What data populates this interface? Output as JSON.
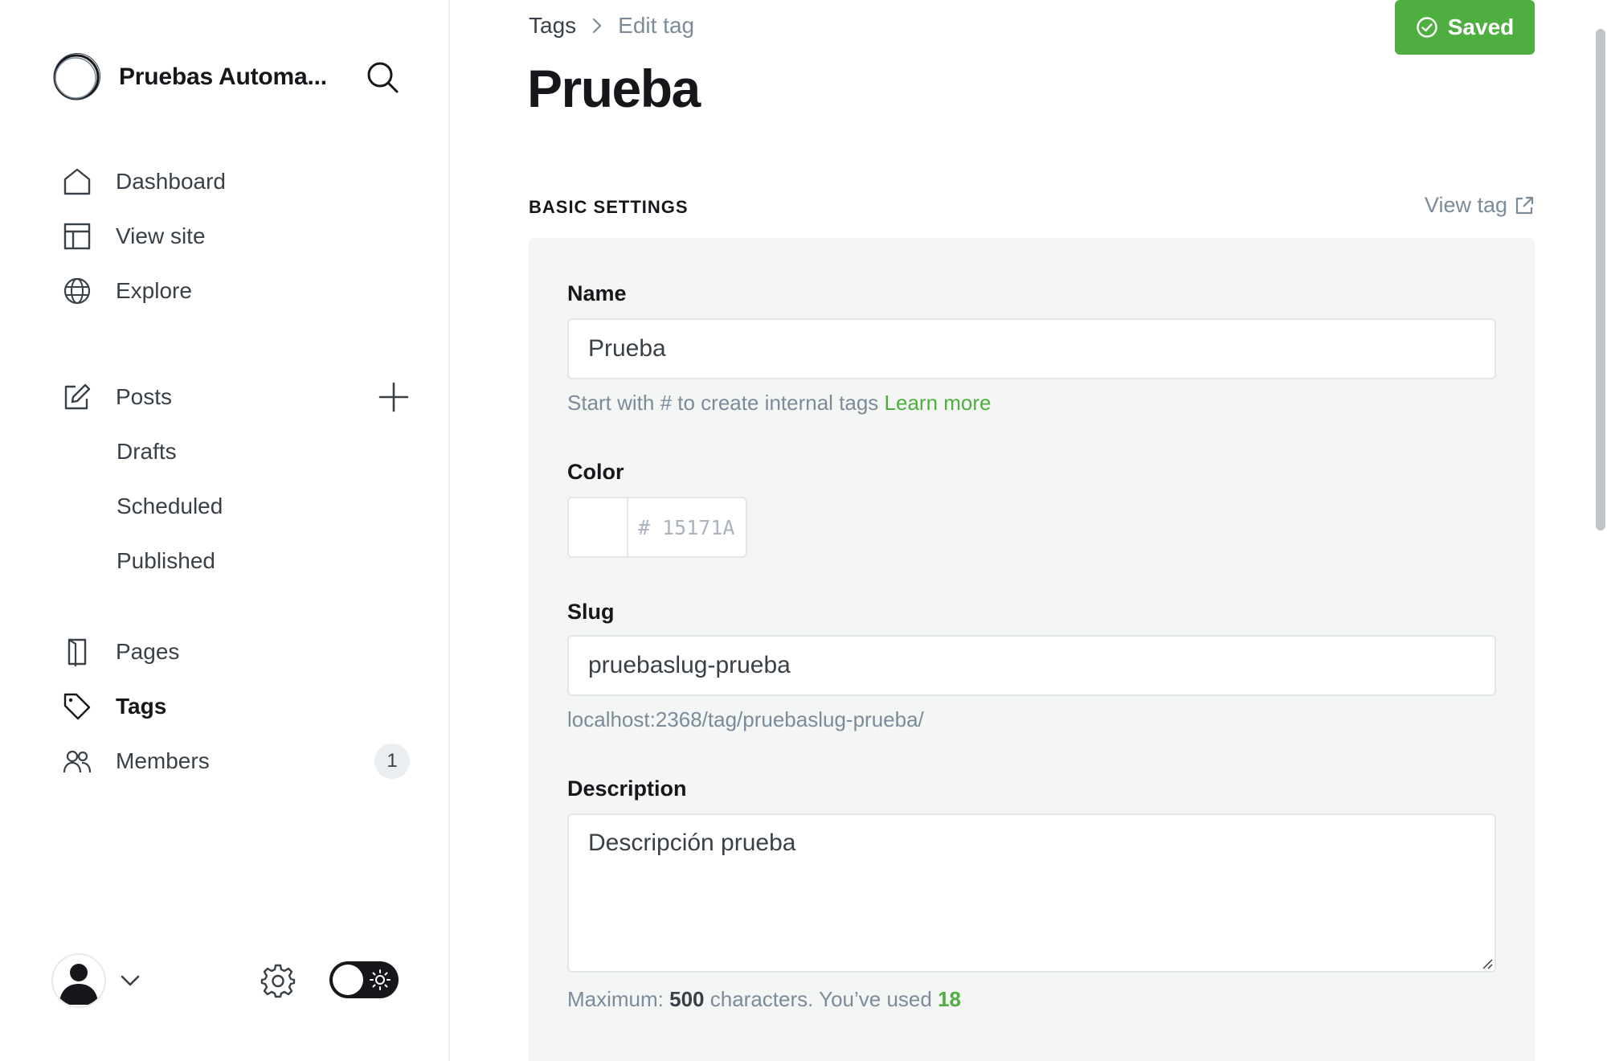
{
  "sidebar": {
    "site_name": "Pruebas Automa...",
    "nav_primary": [
      {
        "label": "Dashboard",
        "icon": "home-icon"
      },
      {
        "label": "View site",
        "icon": "layout-icon"
      },
      {
        "label": "Explore",
        "icon": "globe-icon"
      }
    ],
    "posts": {
      "label": "Posts",
      "icon": "edit-icon"
    },
    "post_subitems": [
      "Drafts",
      "Scheduled",
      "Published"
    ],
    "nav_secondary": [
      {
        "label": "Pages",
        "icon": "page-icon"
      },
      {
        "label": "Tags",
        "icon": "tag-icon",
        "active": true
      },
      {
        "label": "Members",
        "icon": "members-icon",
        "badge": "1"
      }
    ]
  },
  "breadcrumb": {
    "parent": "Tags",
    "current": "Edit tag"
  },
  "page": {
    "title": "Prueba"
  },
  "save_button": {
    "label": "Saved"
  },
  "section": {
    "title": "BASIC SETTINGS",
    "view_link": "View tag"
  },
  "form": {
    "name": {
      "label": "Name",
      "value": "Prueba",
      "hint_text": "Start with # to create internal tags",
      "hint_link": "Learn more"
    },
    "color": {
      "label": "Color",
      "hash": "#",
      "placeholder": "15171A",
      "swatch": "#ffffff"
    },
    "slug": {
      "label": "Slug",
      "value": "pruebaslug-prueba",
      "url": "localhost:2368/tag/pruebaslug-prueba/"
    },
    "description": {
      "label": "Description",
      "value": "Descripción prueba",
      "limit_prefix": "Maximum:",
      "limit": "500",
      "limit_middle": "characters. You’ve used",
      "used": "18"
    }
  },
  "colors": {
    "accent_green": "#4fae40",
    "text_dark": "#15171a",
    "text_muted": "#7c8b9a",
    "panel_bg": "#f4f5f5"
  }
}
